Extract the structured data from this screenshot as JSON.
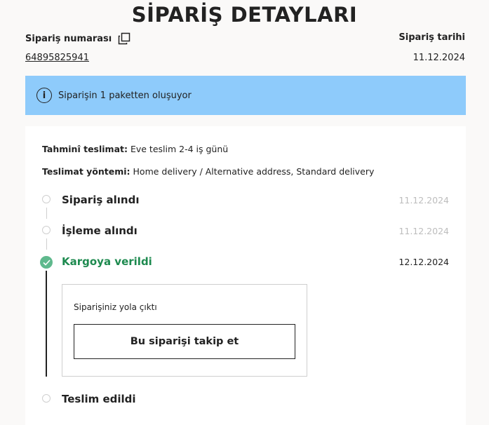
{
  "page": {
    "title": "SİPARİŞ DETAYLARI"
  },
  "order": {
    "number_label": "Sipariş numarası",
    "number": "64895825941",
    "date_label": "Sipariş tarihi",
    "date": "11.12.2024"
  },
  "banner": {
    "icon": "info-icon",
    "text": "Siparişin 1 paketten oluşuyor"
  },
  "delivery": {
    "estimate_label": "Tahminî teslimat:",
    "estimate_value": " Eve teslim 2-4 iş günü",
    "method_label": "Teslimat yöntemi:",
    "method_value": " Home delivery / Alternative address, Standard delivery"
  },
  "steps": [
    {
      "label": "Sipariş alındı",
      "date": "11.12.2024",
      "status": "past"
    },
    {
      "label": "İşleme alındı",
      "date": "11.12.2024",
      "status": "past"
    },
    {
      "label": "Kargoya verildi",
      "date": "12.12.2024",
      "status": "current"
    },
    {
      "label": "Teslim edildi",
      "date": "",
      "status": "pending"
    }
  ],
  "shipment": {
    "message": "Siparişiniz yola çıktı",
    "track_button": "Bu siparişi takip et"
  },
  "colors": {
    "banner": "#8ecbfb",
    "active_green": "#1d8a4f",
    "check_green": "#5fb98d",
    "muted_date": "#bdbdbd"
  }
}
